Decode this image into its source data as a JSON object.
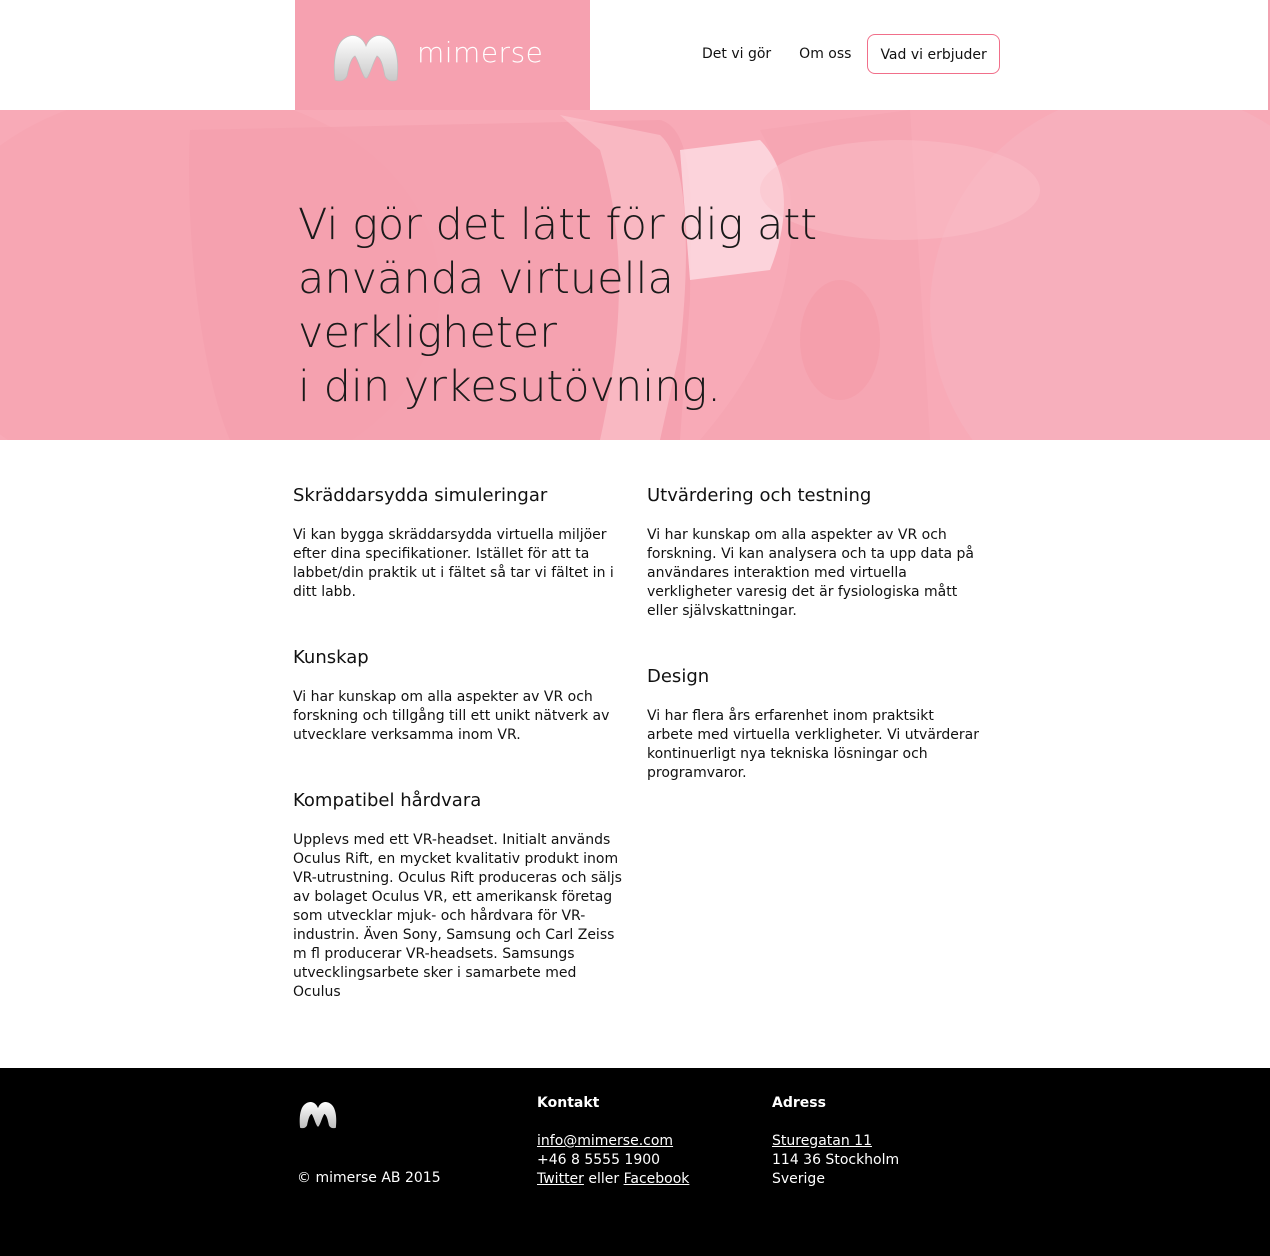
{
  "header": {
    "logo_text": "mimerse",
    "nav": [
      {
        "label": "Det vi gör"
      },
      {
        "label": "Om oss"
      },
      {
        "label": "Vad vi erbjuder"
      }
    ]
  },
  "hero": {
    "title_line1": "Vi gör det lätt för dig att",
    "title_line2": "använda virtuella verkligheter",
    "title_line3": "i din yrkesutövning."
  },
  "sections_left": [
    {
      "title": "Skräddarsydda simuleringar",
      "body": "Vi kan bygga skräddarsydda virtuella miljöer efter dina specifikationer. Istället för att ta labbet/din praktik ut i fältet så tar vi fältet in i ditt labb."
    },
    {
      "title": "Kunskap",
      "body": "Vi har kunskap om alla aspekter av VR och forskning och tillgång till ett unikt nätverk av utvecklare verksamma inom VR."
    },
    {
      "title": "Kompatibel hårdvara",
      "body": "Upplevs med ett VR-headset. Initialt används Oculus Rift, en mycket kvalitativ produkt inom VR-utrustning. Oculus Rift produceras och säljs av bolaget Oculus VR, ett amerikansk företag som utvecklar mjuk- och hårdvara för VR-industrin. Även Sony, Samsung och Carl Zeiss m fl producerar VR-headsets. Samsungs utvecklingsarbete sker i samarbete med Oculus"
    }
  ],
  "sections_right": [
    {
      "title": "Utvärdering och testning",
      "body": "Vi har kunskap om alla aspekter av VR och forskning. Vi kan analysera och ta upp data på användares interaktion med virtuella verkligheter varesig det är fysiologiska mått eller självskattningar."
    },
    {
      "title": "Design",
      "body": "Vi har flera års erfarenhet inom praktsikt arbete med virtuella verkligheter. Vi utvärderar kontinuerligt nya tekniska lösningar och programvaror."
    }
  ],
  "footer": {
    "copyright": "© mimerse AB 2015",
    "kontakt_head": "Kontakt",
    "email": "info@mimerse.com",
    "phone": "+46 8 5555 1900",
    "twitter": "Twitter",
    "eller": "eller",
    "facebook": "Facebook",
    "adress_head": "Adress",
    "street": "Sturegatan 11",
    "city": "114 36 Stockholm",
    "country": "Sverige"
  },
  "colors": {
    "brand_pink": "#f6a1b0",
    "hero_pink": "#f8aab7",
    "nav_active_border": "#f16f8a"
  },
  "icons": [
    "mimerse-logo-icon"
  ]
}
